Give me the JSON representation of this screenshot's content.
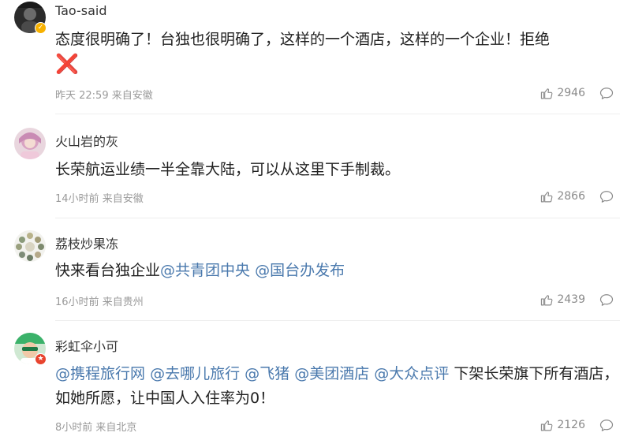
{
  "comments": [
    {
      "username": "Tao-said",
      "text": "态度很明确了！台独也很明确了，这样的一个酒店，这样的一个企业！拒绝",
      "emoji": "❌",
      "time": "昨天 22:59",
      "location": "来自安徽",
      "likes": "2946",
      "verified": true
    },
    {
      "username": "火山岩的灰",
      "text": "长荣航运业绩一半全靠大陆，可以从这里下手制裁。",
      "time": "14小时前",
      "location": "来自安徽",
      "likes": "2866"
    },
    {
      "username": "荔枝炒果冻",
      "text": "快来看台独企业",
      "mentions": [
        "@共青团中央",
        "@国台办发布"
      ],
      "time": "16小时前",
      "location": "来自贵州",
      "likes": "2439"
    },
    {
      "username": "彩虹伞小可",
      "mentions": [
        "@携程旅行网",
        "@去哪儿旅行",
        "@飞猪",
        "@美团酒店",
        "@大众点评"
      ],
      "text": "下架长荣旗下所有酒店，如她所愿，让中国人入住率为0！",
      "time": "8小时前",
      "location": "来自北京",
      "likes": "2126"
    }
  ],
  "icons": {
    "like": "thumbs-up-icon",
    "comment": "speech-bubble-icon",
    "verified": "verified-badge-icon"
  },
  "colors": {
    "mention": "#4a79ad",
    "meta": "#9a9a9a",
    "emoji_cross": "#ec4c76",
    "verified_badge": "#f7b100"
  }
}
